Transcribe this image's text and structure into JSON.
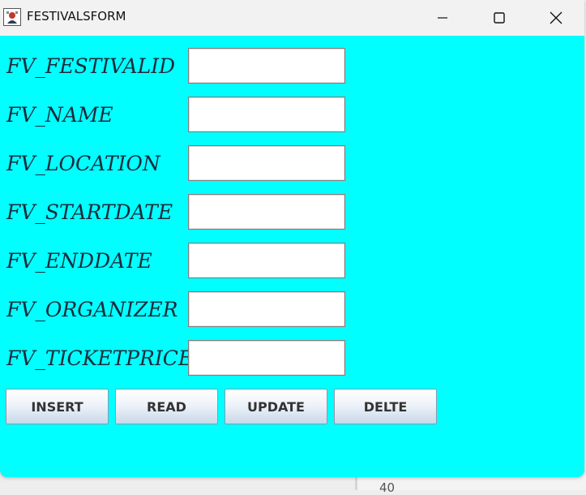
{
  "window": {
    "title": "FESTIVALSFORM"
  },
  "background": {
    "partial_text": "40"
  },
  "form": {
    "fields": [
      {
        "label": "FV_FESTIVALID",
        "value": ""
      },
      {
        "label": "FV_NAME",
        "value": ""
      },
      {
        "label": "FV_LOCATION",
        "value": ""
      },
      {
        "label": "FV_STARTDATE",
        "value": ""
      },
      {
        "label": "FV_ENDDATE",
        "value": ""
      },
      {
        "label": "FV_ORGANIZER",
        "value": ""
      },
      {
        "label": "FV_TICKETPRICE",
        "value": ""
      }
    ]
  },
  "buttons": {
    "insert": "INSERT",
    "read": "READ",
    "update": "UPDATE",
    "delete": "DELTE"
  },
  "colors": {
    "form_background": "#00ffff",
    "titlebar": "#f2f2f2",
    "label_text": "#1b2b3b"
  },
  "icons": {
    "app": "java-app-icon",
    "minimize": "minimize-icon",
    "maximize": "maximize-icon",
    "close": "close-icon"
  }
}
